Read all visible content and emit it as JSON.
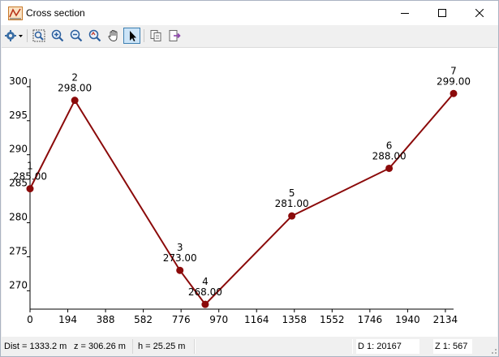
{
  "window": {
    "title": "Cross section"
  },
  "toolbar": {
    "icons": [
      "settings-dropdown",
      "zoom-extents",
      "zoom-in",
      "zoom-out",
      "zoom-previous",
      "pan-hand",
      "select-pointer",
      "copy",
      "export"
    ]
  },
  "chart_data": {
    "type": "line",
    "x": [
      0,
      230,
      770,
      900,
      1345,
      1845,
      2176
    ],
    "y": [
      285.0,
      298.0,
      273.0,
      268.0,
      281.0,
      288.0,
      299.0
    ],
    "point_labels": [
      "1",
      "2",
      "3",
      "4",
      "5",
      "6",
      "7"
    ],
    "value_labels": [
      "285.00",
      "298.00",
      "273.00",
      "268.00",
      "281.00",
      "288.00",
      "299.00"
    ],
    "x_ticks": [
      "0",
      "194",
      "388",
      "582",
      "776",
      "970",
      "1164",
      "1358",
      "1552",
      "1746",
      "1940",
      "2134"
    ],
    "y_ticks": [
      "270",
      "275",
      "280",
      "285",
      "290",
      "295",
      "300"
    ],
    "xlim": [
      0,
      2176
    ],
    "ylim": [
      267.3,
      300.7
    ],
    "colors": {
      "line": "#8b0a0a",
      "marker": "#8b0a0a"
    },
    "grid": false
  },
  "status": {
    "dist": "Dist = 1333.2 m",
    "z": "z = 306.26 m",
    "h": "h = 25.25 m",
    "d_scale": "D  1: 20167",
    "z_scale": "Z  1: 567"
  }
}
